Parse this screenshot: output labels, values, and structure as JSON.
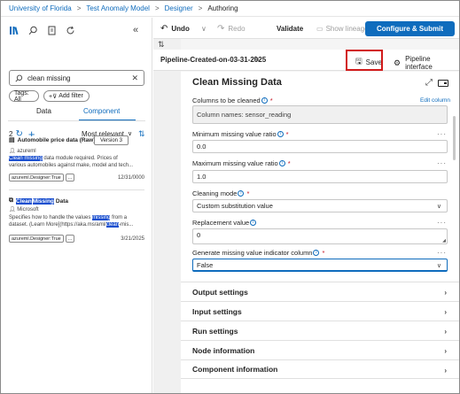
{
  "breadcrumb": {
    "items": [
      "University of Florida",
      "Test Anomaly Model",
      "Designer",
      "Authoring"
    ]
  },
  "left_panel": {
    "search_value": "clean missing",
    "filter_tag": "Tags: All",
    "add_filter": "Add filter",
    "tabs": [
      "Data",
      "Component"
    ],
    "active_tab": "Component",
    "result_count": "2",
    "sort_label": "Most relevant",
    "cards": [
      {
        "title": "Automobile price data (Raw)",
        "version": "Version 3",
        "author": "azureml",
        "desc_hl": "Clean missing",
        "desc_rest": " data module required. Prices of",
        "desc_line2": "various automobiles against make, model and tech...",
        "tag": "azureml.Designer:True",
        "tag_more": "...",
        "date": "12/31/0000"
      },
      {
        "title_hl1": "Clean",
        "title_hl2": "Missing",
        "title_rest": "Data",
        "author": "Microsoft",
        "desc_line1_a": "Specifies how to handle the values ",
        "desc_line1_hl": "missing",
        "desc_line1_b": " from a",
        "desc_line2_a": "dataset. (Learn More](https://aka.ms/aml/",
        "desc_line2_hl": "clean",
        "desc_line2_b": "-mis...",
        "tag": "azureml.Designer:True",
        "tag_more": "...",
        "date": "3/21/2025"
      }
    ]
  },
  "toolbar": {
    "undo": "Undo",
    "redo": "Redo",
    "validate": "Validate",
    "show_lineage": "Show lineage",
    "more": "···",
    "configure_submit": "Configure & Submit"
  },
  "pipeline": {
    "name": "Pipeline-Created-on-03-31-2025",
    "save": "Save",
    "pipeline_interface": "Pipeline interface"
  },
  "properties": {
    "title": "Clean Missing Data",
    "columns_label": "Columns to be cleaned",
    "edit_column": "Edit column",
    "columns_value": "Column names: sensor_reading",
    "min_ratio_label": "Minimum missing value ratio",
    "min_ratio_value": "0.0",
    "max_ratio_label": "Maximum missing value ratio",
    "max_ratio_value": "1.0",
    "cleaning_mode_label": "Cleaning mode",
    "cleaning_mode_value": "Custom substitution value",
    "replacement_label": "Replacement value",
    "replacement_value": "0",
    "indicator_label": "Generate missing value indicator column",
    "indicator_value": "False",
    "required_mark": "*",
    "sections": [
      "Output settings",
      "Input settings",
      "Run settings",
      "Node information",
      "Component information"
    ]
  },
  "colors": {
    "accent": "#0f6cbd",
    "highlight_box": "#d11a1a"
  }
}
